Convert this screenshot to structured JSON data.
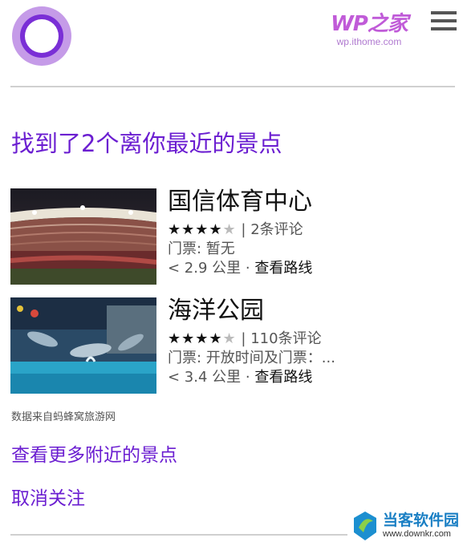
{
  "header": {
    "logo_brand": "WP之家",
    "logo_url": "wp.ithome.com"
  },
  "results": {
    "heading": "找到了2个离你最近的景点",
    "places": [
      {
        "name": "国信体育中心",
        "rating": 4,
        "rating_max": 5,
        "stars_on": "★★★★",
        "stars_off": "★",
        "reviews": "| 2条评论",
        "ticket": "门票: 暂无",
        "distance": "< 2.9 公里 · ",
        "route_label": "查看路线"
      },
      {
        "name": "海洋公园",
        "rating": 4,
        "rating_max": 5,
        "stars_on": "★★★★",
        "stars_off": "★",
        "reviews": "| 110条评论",
        "ticket": "门票: 开放时间及门票：...",
        "distance": "< 3.4 公里 · ",
        "route_label": "查看路线"
      }
    ],
    "source": "数据来自蚂蜂窝旅游网"
  },
  "actions": {
    "more_label": "查看更多附近的景点",
    "unfollow_label": "取消关注"
  },
  "watermark": {
    "title": "当客软件园",
    "url": "www.downkr.com"
  },
  "colors": {
    "accent": "#6b1ed1",
    "cortana_ring": "#7a2fd6"
  }
}
